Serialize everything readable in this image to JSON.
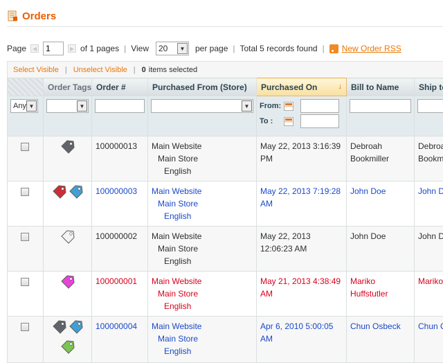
{
  "header": {
    "title": "Orders",
    "icon": "document-icon"
  },
  "pager": {
    "page_label": "Page",
    "page_value": "1",
    "of_pages": "of 1 pages",
    "view_label": "View",
    "view_value": "20",
    "per_page": "per page",
    "total": "Total 5 records found",
    "rss_label": "New Order RSS"
  },
  "massaction": {
    "select_visible": "Select Visible",
    "unselect_visible": "Unselect Visible",
    "selected_count": "0",
    "selected_suffix": "items selected"
  },
  "columns": {
    "tags": "Order Tags",
    "order_no": "Order #",
    "store": "Purchased From (Store)",
    "purchased_on": "Purchased On",
    "bill_to": "Bill to Name",
    "ship_to": "Ship to"
  },
  "filters": {
    "any": "Any",
    "from_label": "From:",
    "to_label": "To :"
  },
  "colors": {
    "accent": "#eb5e00",
    "link_blue": "#1b49c8",
    "row_red": "#d6001c",
    "tag_dark": "#5a5e63",
    "tag_red": "#c8242f",
    "tag_blue": "#3a9ad0",
    "tag_white": "#f3f3f3",
    "tag_magenta": "#e53bd8",
    "tag_green": "#74c24a"
  },
  "rows": [
    {
      "order_no": "100000013",
      "store": [
        "Main Website",
        "Main Store",
        "English"
      ],
      "purchased_on": [
        "May 22, 2013 3:16:39",
        "PM"
      ],
      "bill_to": [
        "Debroah",
        "Bookmiller"
      ],
      "ship_to": [
        "Debroah",
        "Bookmi"
      ],
      "tags": [
        "tag_dark"
      ]
    },
    {
      "order_no": "100000003",
      "store": [
        "Main Website",
        "Main Store",
        "English"
      ],
      "purchased_on": [
        "May 22, 2013 7:19:28",
        "AM"
      ],
      "bill_to": [
        "John Doe"
      ],
      "ship_to": [
        "John D"
      ],
      "tags": [
        "tag_red",
        "tag_blue"
      ]
    },
    {
      "order_no": "100000002",
      "store": [
        "Main Website",
        "Main Store",
        "English"
      ],
      "purchased_on": [
        "May 22, 2013",
        "12:06:23 AM"
      ],
      "bill_to": [
        "John Doe"
      ],
      "ship_to": [
        "John D"
      ],
      "tags": [
        "tag_white"
      ]
    },
    {
      "order_no": "100000001",
      "store": [
        "Main Website",
        "Main Store",
        "English"
      ],
      "purchased_on": [
        "May 21, 2013 4:38:49",
        "AM"
      ],
      "bill_to": [
        "Mariko",
        "Huffstutler"
      ],
      "ship_to": [
        "Mariko"
      ],
      "tags": [
        "tag_magenta"
      ]
    },
    {
      "order_no": "100000004",
      "store": [
        "Main Website",
        "Main Store",
        "English"
      ],
      "purchased_on": [
        "Apr 6, 2010 5:00:05",
        "AM"
      ],
      "bill_to": [
        "Chun Osbeck"
      ],
      "ship_to": [
        "Chun O"
      ],
      "tags": [
        "tag_dark",
        "tag_blue",
        "tag_green"
      ]
    }
  ]
}
